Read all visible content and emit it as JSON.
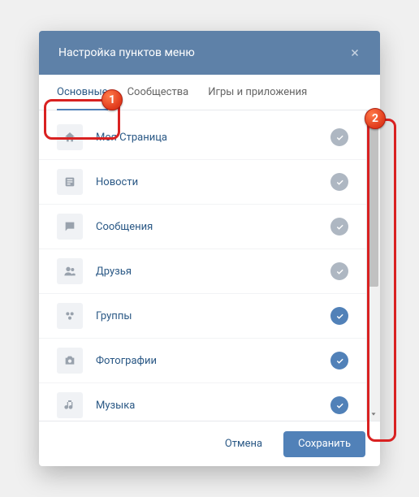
{
  "modal": {
    "title": "Настройка пунктов меню",
    "tabs": {
      "main": "Основные",
      "communities": "Сообщества",
      "games": "Игры и приложения"
    },
    "items": {
      "my_page": "Моя Страница",
      "news": "Новости",
      "messages": "Сообщения",
      "friends": "Друзья",
      "groups": "Группы",
      "photos": "Фотографии",
      "music": "Музыка"
    },
    "footer": {
      "cancel": "Отмена",
      "save": "Сохранить"
    }
  },
  "annotations": {
    "marker1": "1",
    "marker2": "2"
  }
}
